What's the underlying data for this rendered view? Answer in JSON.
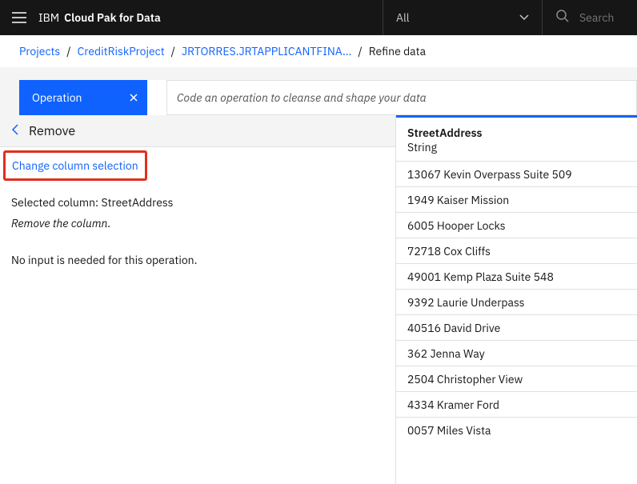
{
  "topbar": {
    "brand_prefix": "IBM",
    "brand_product": "Cloud Pak for Data",
    "scope_label": "All",
    "search_placeholder": "Search"
  },
  "breadcrumb": {
    "items": [
      {
        "label": "Projects"
      },
      {
        "label": "CreditRiskProject"
      },
      {
        "label": "JRTORRES.JRTAPPLICANTFINA..."
      }
    ],
    "current": "Refine data"
  },
  "operation": {
    "tab_label": "Operation",
    "code_prompt": "Code an operation to cleanse and shape your data"
  },
  "panel": {
    "title": "Remove",
    "change_selection": "Change column selection",
    "selected_prefix": "Selected column: ",
    "selected_column": "StreetAddress",
    "description": "Remove the column.",
    "no_input": "No input is needed for this operation."
  },
  "column": {
    "name": "StreetAddress",
    "type": "String",
    "rows": [
      "13067 Kevin Overpass Suite 509",
      "1949 Kaiser Mission",
      "6005 Hooper Locks",
      "72718 Cox Cliffs",
      "49001 Kemp Plaza Suite 548",
      "9392 Laurie Underpass",
      "40516 David Drive",
      "362 Jenna Way",
      "2504 Christopher View",
      "4334 Kramer Ford",
      "0057 Miles Vista"
    ]
  }
}
